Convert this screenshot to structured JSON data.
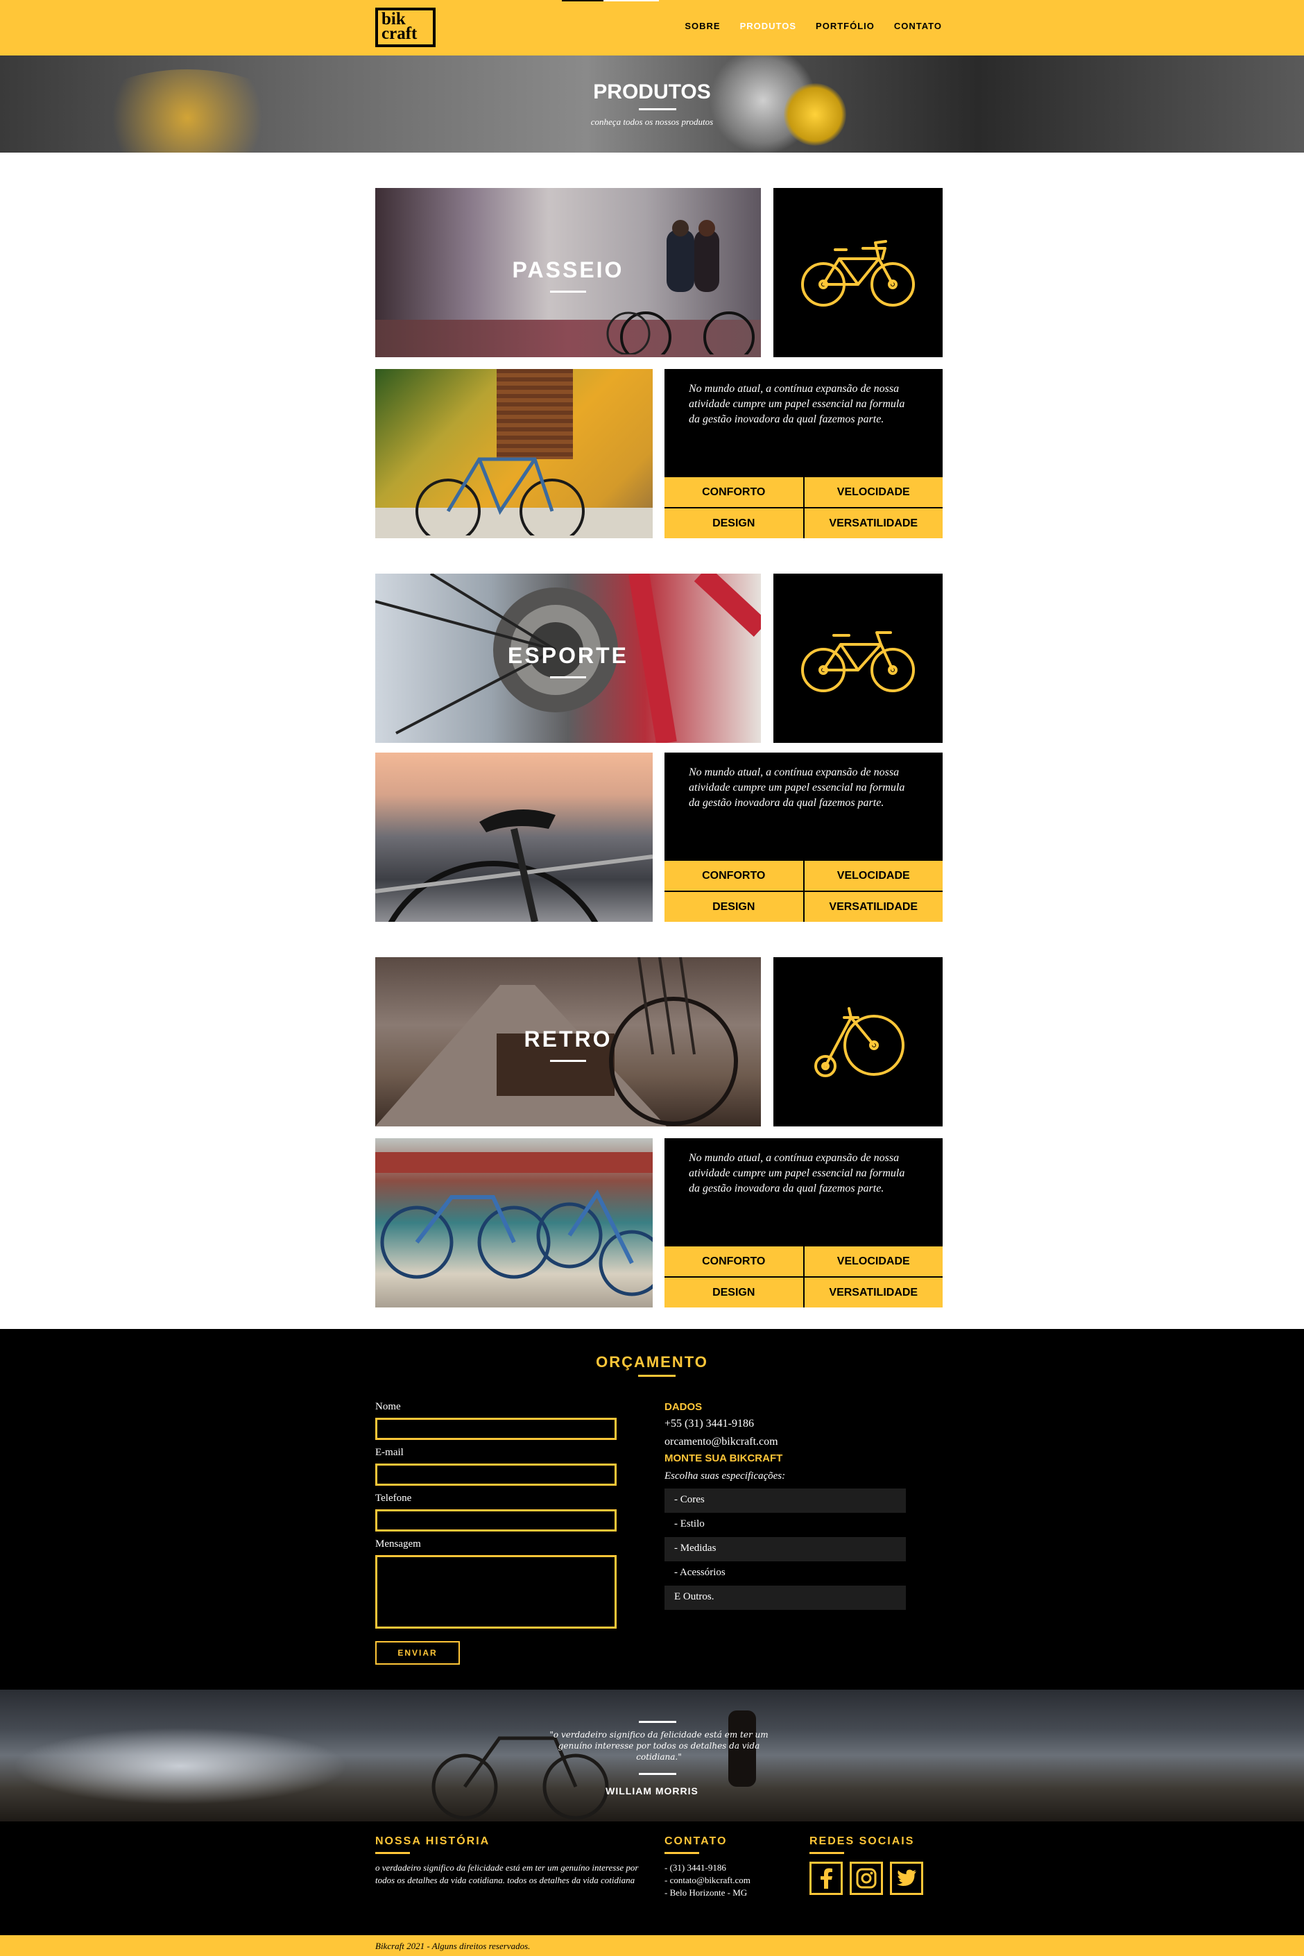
{
  "header": {
    "logo_line1": "bik",
    "logo_line2": "craft",
    "nav": [
      "SOBRE",
      "PRODUTOS",
      "PORTFÓLIO",
      "CONTATO"
    ],
    "active_nav": "PRODUTOS"
  },
  "hero": {
    "title": "PRODUTOS",
    "subtitle": "conheça todos os nossos produtos"
  },
  "products": [
    {
      "name": "PASSEIO",
      "icon": "bicycle-icon",
      "description": "No mundo atual, a contínua expansão de nossa atividade cumpre um papel essencial na formula da gestão inovadora da qual fazemos parte.",
      "features": [
        "CONFORTO",
        "VELOCIDADE",
        "DESIGN",
        "VERSATILIDADE"
      ]
    },
    {
      "name": "ESPORTE",
      "icon": "road-bike-icon",
      "description": "No mundo atual, a contínua expansão de nossa atividade cumpre um papel essencial na formula da gestão inovadora da qual fazemos parte.",
      "features": [
        "CONFORTO",
        "VELOCIDADE",
        "DESIGN",
        "VERSATILIDADE"
      ]
    },
    {
      "name": "RETRO",
      "icon": "penny-farthing-icon",
      "description": "No mundo atual, a contínua expansão de nossa atividade cumpre um papel essencial na formula da gestão inovadora da qual fazemos parte.",
      "features": [
        "CONFORTO",
        "VELOCIDADE",
        "DESIGN",
        "VERSATILIDADE"
      ]
    }
  ],
  "quote_form": {
    "title": "ORÇAMENTO",
    "labels": {
      "name": "Nome",
      "email": "E-mail",
      "phone": "Telefone",
      "message": "Mensagem"
    },
    "values": {
      "name": "",
      "email": "",
      "phone": "",
      "message": ""
    },
    "submit": "ENVIAR",
    "data_title": "DADOS",
    "phone": "+55 (31) 3441-9186",
    "email": "orcamento@bikcraft.com",
    "build_title": "MONTE SUA BIKCRAFT",
    "build_intro": "Escolha suas especificações:",
    "specs": [
      "- Cores",
      "- Estilo",
      "- Medidas",
      "- Acessórios",
      "E Outros."
    ]
  },
  "quote": {
    "text": "\"o verdadeiro significo da felicidade está em ter um genuíno interesse por todos os detalhes da vida cotidiana.\"",
    "author": "WILLIAM MORRIS"
  },
  "footer": {
    "history_title": "NOSSA HISTÓRIA",
    "history_text": "o verdadeiro significo da felicidade está em ter um genuíno interesse por todos os detalhes da vida cotidiana. todos os detalhes da vida cotidiana",
    "contact_title": "CONTATO",
    "contact_lines": [
      "- (31) 3441-9186",
      "- contato@bikcraft.com",
      "- Belo Horizonte - MG"
    ],
    "social_title": "REDES SOCIAIS",
    "social": [
      "facebook-icon",
      "instagram-icon",
      "twitter-icon"
    ],
    "copyright": "Bikcraft 2021 - Alguns direitos reservados."
  },
  "colors": {
    "accent": "#ffc638",
    "dark": "#000000",
    "light": "#ffffff"
  }
}
